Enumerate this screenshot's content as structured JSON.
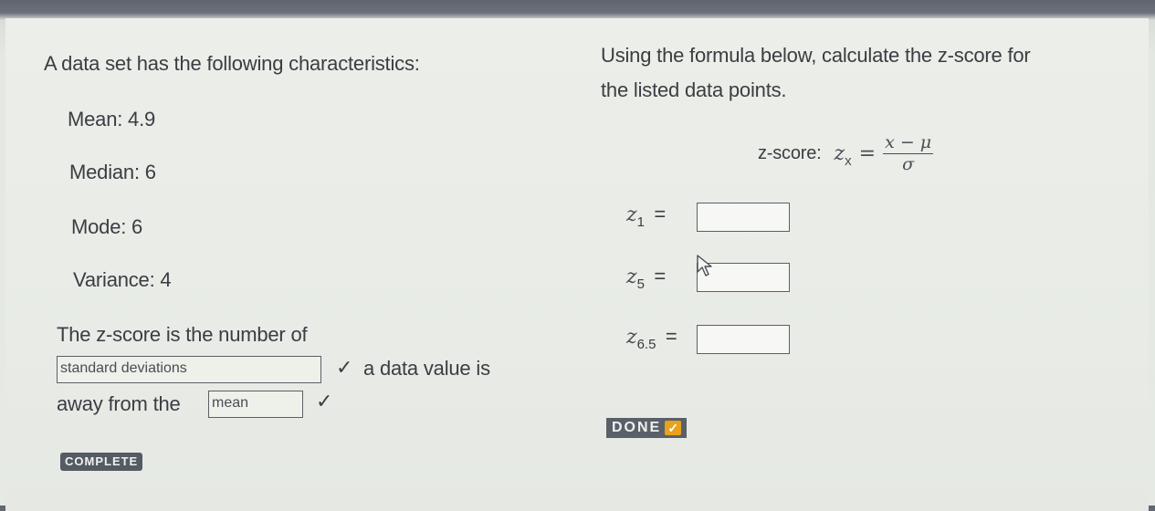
{
  "left": {
    "intro": "A data set has the following characteristics:",
    "mean": "Mean: 4.9",
    "median": "Median: 6",
    "mode": "Mode: 6",
    "variance": "Variance: 4"
  },
  "sentence": {
    "part1": "The z-score is the number of",
    "dropdown1_value": "standard deviations",
    "part2": "a data value is",
    "part3": "away from the",
    "dropdown2_value": "mean",
    "check": "✓"
  },
  "right": {
    "instruction_line1": "Using the formula below, calculate the z-score for",
    "instruction_line2": "the listed data points.",
    "formula_label": "z-score:",
    "formula_var": "z",
    "formula_sub": "x",
    "formula_eq": "=",
    "formula_numerator": "x − μ",
    "formula_denominator": "σ",
    "z1_var": "z",
    "z1_sub": "1",
    "z5_var": "z",
    "z5_sub": "5",
    "z65_var": "z",
    "z65_sub": "6.5",
    "eq": "="
  },
  "inputs": {
    "z1_value": "",
    "z5_value": "",
    "z65_value": ""
  },
  "badges": {
    "done": "DONE",
    "done_check": "✓",
    "complete": "COMPLETE"
  }
}
